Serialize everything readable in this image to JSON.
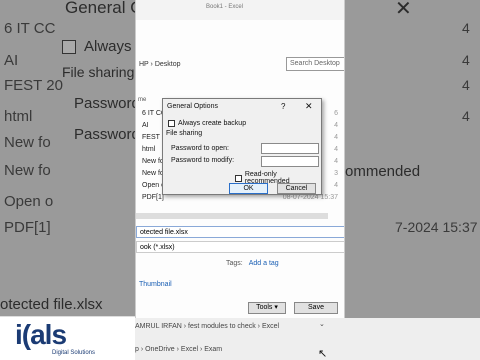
{
  "bg": {
    "title": "General Opti",
    "close": "✕",
    "checkbox_text": "Always c",
    "file_sharing": "File sharing",
    "password": "Password",
    "recommended": "ommended",
    "side_items": [
      "6 IT CC",
      "AI",
      "FEST 20",
      "html",
      "New fo",
      "New fo",
      "Open o",
      "PDF[1]"
    ],
    "right_items": [
      "4",
      "4",
      "4",
      "4",
      "",
      "",
      "",
      "7-2024 15:37"
    ],
    "bottom_name": "otected file.xlsx",
    "bottom_type": "ook (*.xlsx)"
  },
  "panel": {
    "window_title": "Book1 - Excel",
    "breadcrumb": "HP  ›  Desktop",
    "search_placeholder": "Search Desktop",
    "header_label": "me",
    "files": [
      {
        "name": "6 IT CC",
        "date": "6"
      },
      {
        "name": "AI",
        "date": "4"
      },
      {
        "name": "FEST 20",
        "date": "4"
      },
      {
        "name": "html",
        "date": "4"
      },
      {
        "name": "New fol",
        "date": "4"
      },
      {
        "name": "New fol",
        "date": "3"
      },
      {
        "name": "Open ot",
        "date": "4"
      },
      {
        "name": "PDF[1]",
        "date": "08-07-2024 15:37"
      }
    ],
    "file_name": "otected file.xlsx",
    "file_type": "ook (*.xlsx)",
    "tags_label": "Tags:",
    "add_tag": "Add a tag",
    "thumbnail": "Thumbnail",
    "tools_label": "Tools",
    "save_label": "Save"
  },
  "bottom": {
    "path1": "AMRUL IRFAN › fest modules to check › Excel",
    "path2": "p › OneDrive › Excel › Exam"
  },
  "logo": {
    "main": "i(als",
    "sub": "Digital Solutions"
  },
  "dialog": {
    "title": "General Options",
    "help": "?",
    "close": "✕",
    "always_backup": "Always create backup",
    "file_sharing": "File sharing",
    "password_open": "Password to open:",
    "password_modify": "Password to modify:",
    "read_only": "Read-only recommended",
    "ok": "OK",
    "cancel": "Cancel"
  },
  "colors": {
    "accent": "#2a6fc9",
    "logo": "#1b3b74"
  }
}
